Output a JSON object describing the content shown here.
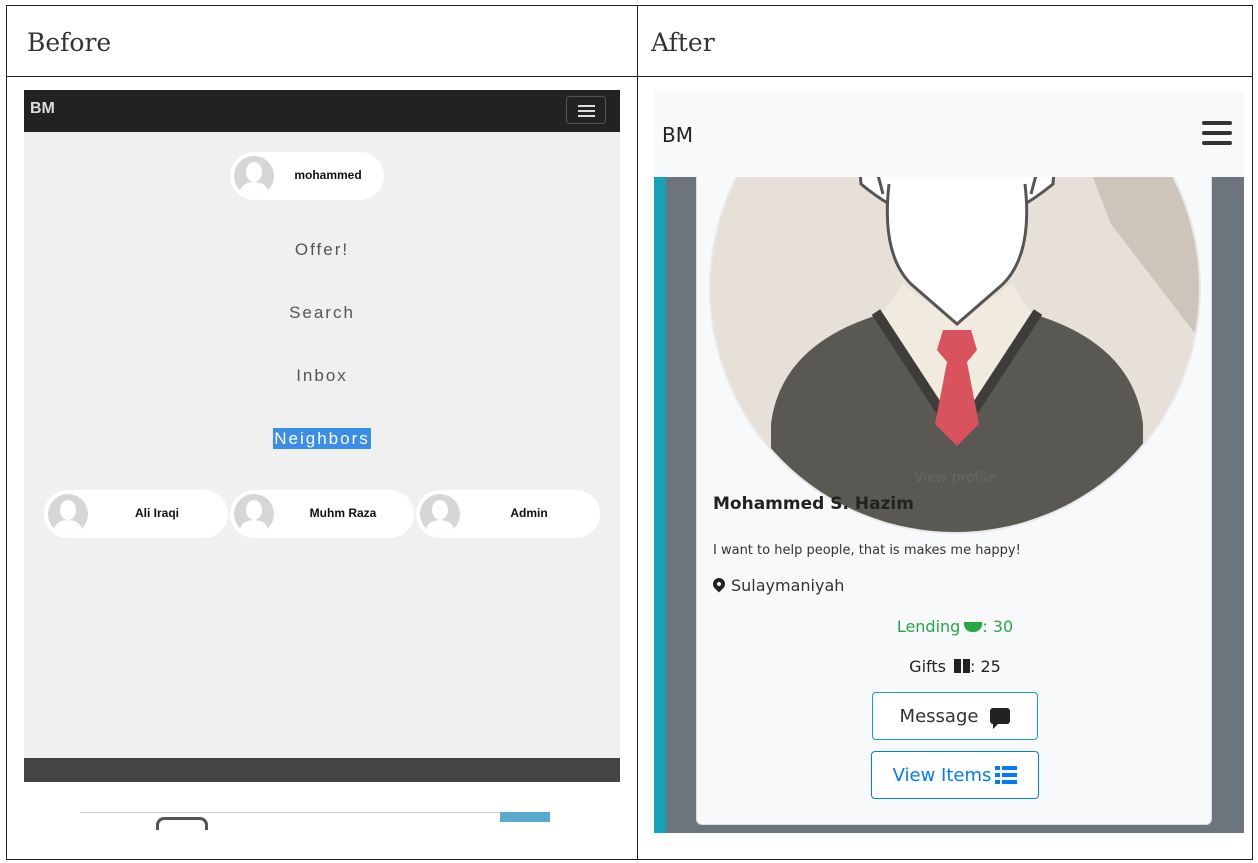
{
  "table": {
    "before_caption": "Before",
    "after_caption": "After"
  },
  "before": {
    "brand": "BM",
    "current_user": "mohammed",
    "menu": [
      {
        "label": "Offer!"
      },
      {
        "label": "Search"
      },
      {
        "label": "Inbox"
      },
      {
        "label": "Neighbors",
        "selected": true
      }
    ],
    "neighbors": [
      {
        "name": "Ali Iraqi"
      },
      {
        "name": "Muhm Raza"
      },
      {
        "name": "Admin"
      }
    ]
  },
  "after": {
    "brand": "BM",
    "view_profile": "View profile",
    "name": "Mohammed S. Hazim",
    "bio": "I want to help people, that is makes me happy!",
    "location": "Sulaymaniyah",
    "lending_label": "Lending",
    "lending_count": ": 30",
    "gifts_label": "Gifts",
    "gifts_count": ": 25",
    "message_label": "Message",
    "view_items_label": "View Items",
    "colors": {
      "lending": "#28a745",
      "accent_teal": "#17a2b8",
      "primary": "#007bff"
    }
  }
}
